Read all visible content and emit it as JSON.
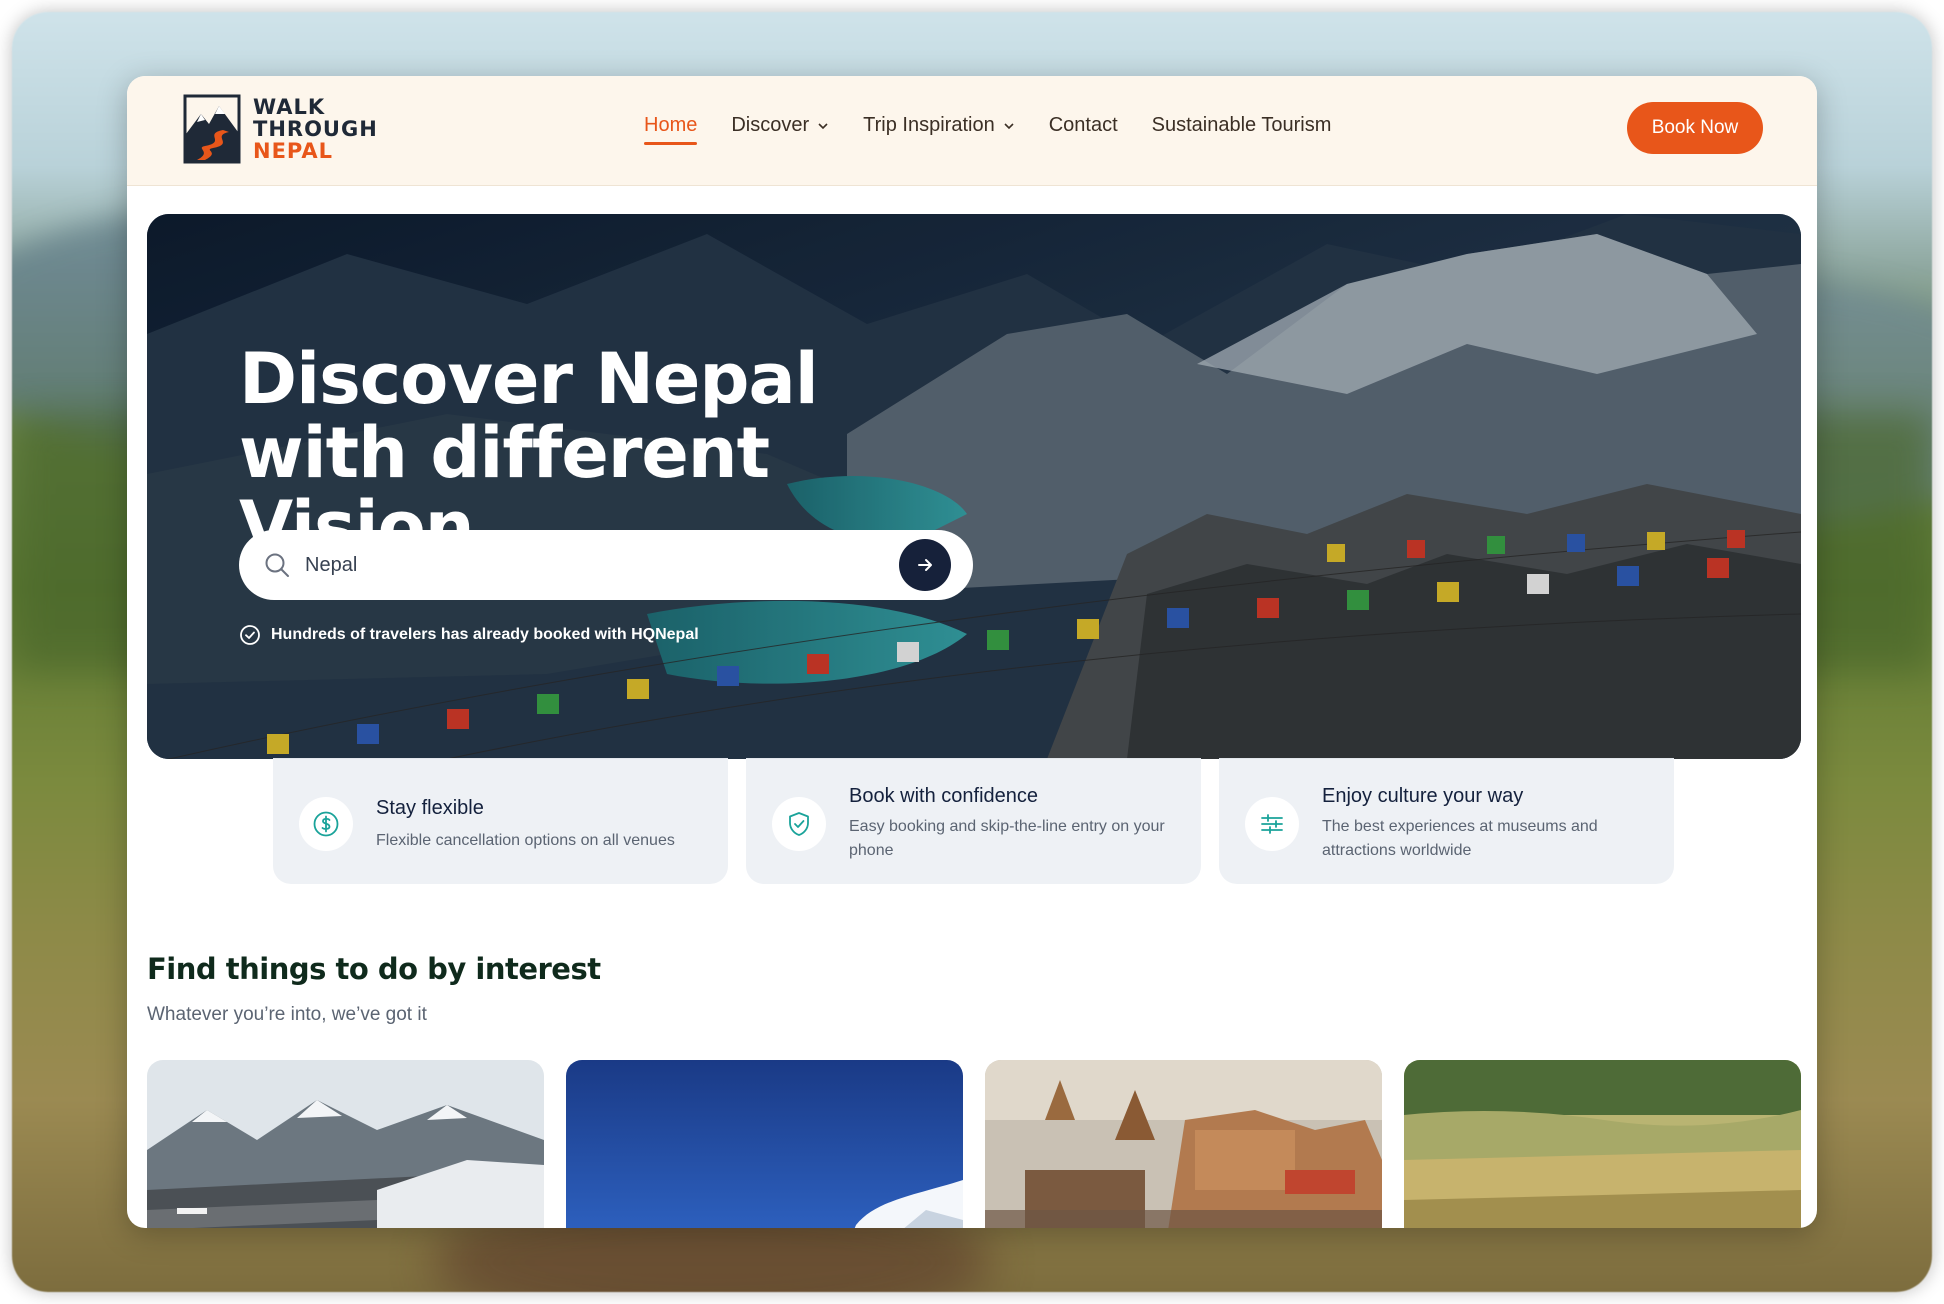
{
  "brand": {
    "line1": "WALK",
    "line2": "THROUGH",
    "line3": "NEPAL",
    "accent_color": "#e8561a",
    "dark_color": "#1f2937"
  },
  "nav": {
    "items": [
      {
        "label": "Home",
        "active": true,
        "has_dropdown": false
      },
      {
        "label": "Discover",
        "active": false,
        "has_dropdown": true
      },
      {
        "label": "Trip Inspiration",
        "active": false,
        "has_dropdown": true
      },
      {
        "label": "Contact",
        "active": false,
        "has_dropdown": false
      },
      {
        "label": "Sustainable Tourism",
        "active": false,
        "has_dropdown": false
      }
    ],
    "cta_label": "Book Now"
  },
  "hero": {
    "title": "Discover Nepal with different Vision",
    "search": {
      "value": "Nepal",
      "icon": "search-icon",
      "submit_icon": "arrow-right-icon"
    },
    "trust_text": "Hundreds of travelers has already booked with HQNepal"
  },
  "features": [
    {
      "icon": "dollar-circle-icon",
      "title": "Stay flexible",
      "description": "Flexible cancellation options on all venues"
    },
    {
      "icon": "shield-check-icon",
      "title": "Book with confidence",
      "description": "Easy booking and skip-the-line entry on your phone"
    },
    {
      "icon": "sliders-icon",
      "title": "Enjoy culture your way",
      "description": "The best experiences at museums and attractions worldwide"
    }
  ],
  "interest": {
    "title": "Find things to do by interest",
    "subtitle": "Whatever you’re into, we’ve got it",
    "cards": [
      {
        "image": "mountain-airstrip"
      },
      {
        "image": "blue-sky-peak"
      },
      {
        "image": "stupa-temple"
      },
      {
        "image": "grassland"
      }
    ]
  }
}
